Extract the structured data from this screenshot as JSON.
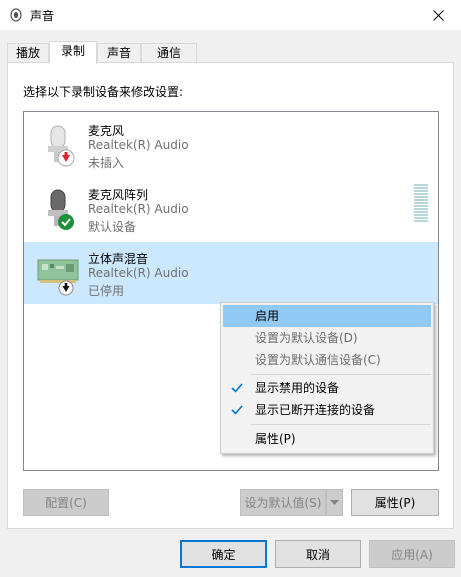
{
  "window": {
    "title": "声音"
  },
  "tabs": [
    {
      "label": "播放",
      "active": false
    },
    {
      "label": "录制",
      "active": true
    },
    {
      "label": "声音",
      "active": false
    },
    {
      "label": "通信",
      "active": false
    }
  ],
  "instruction": "选择以下录制设备来修改设置:",
  "devices": [
    {
      "name": "麦克风",
      "driver": "Realtek(R) Audio",
      "status": "未插入",
      "badge": "red-down-arrow-icon"
    },
    {
      "name": "麦克风阵列",
      "driver": "Realtek(R) Audio",
      "status": "默认设备",
      "badge": "green-check-icon"
    },
    {
      "name": "立体声混音",
      "driver": "Realtek(R) Audio",
      "status": "已停用",
      "badge": "black-down-arrow-icon",
      "selected": true
    }
  ],
  "context_menu": {
    "items": [
      {
        "label": "启用",
        "highlighted": true,
        "disabled": false,
        "checked": false
      },
      {
        "label": "设置为默认设备(D)",
        "highlighted": false,
        "disabled": true,
        "checked": false
      },
      {
        "label": "设置为默认通信设备(C)",
        "highlighted": false,
        "disabled": true,
        "checked": false
      },
      {
        "label": "显示禁用的设备",
        "highlighted": false,
        "disabled": false,
        "checked": true
      },
      {
        "label": "显示已断开连接的设备",
        "highlighted": false,
        "disabled": false,
        "checked": true
      },
      {
        "label": "属性(P)",
        "highlighted": false,
        "disabled": false,
        "checked": false
      }
    ]
  },
  "panel_buttons": {
    "configure": "配置(C)",
    "set_default": "设为默认值(S)",
    "properties": "属性(P)"
  },
  "dialog_buttons": {
    "ok": "确定",
    "cancel": "取消",
    "apply": "应用(A)"
  },
  "colors": {
    "selection": "#cce8ff",
    "menu_highlight": "#91c9f7",
    "accent": "#0078d7",
    "check": "#0078d7"
  }
}
